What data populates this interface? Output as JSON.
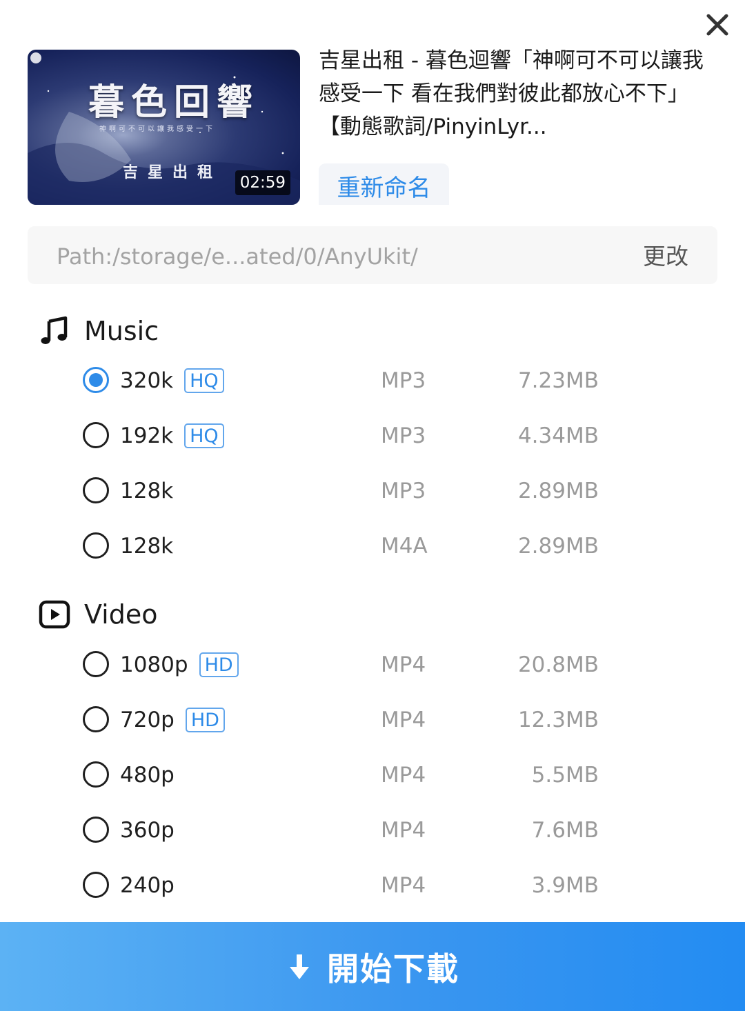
{
  "header": {
    "close_icon": "close-icon"
  },
  "video": {
    "duration": "02:59",
    "thumbnail_title": "暮色回響",
    "thumbnail_subtitle": "神啊可不可以讓我感受一下",
    "thumbnail_artist": "吉星出租",
    "title": "吉星出租 - 暮色迴響「神啊可不可以讓我感受一下 看在我們對彼此都放心不下」【動態歌詞/PinyinLyr...",
    "rename_label": "重新命名"
  },
  "path": {
    "value": "Path:/storage/e...ated/0/AnyUkit/",
    "change_label": "更改"
  },
  "music": {
    "label": "Music",
    "icon": "music-note-icon",
    "options": [
      {
        "quality": "320k",
        "badge": "HQ",
        "format": "MP3",
        "size": "7.23MB",
        "selected": true
      },
      {
        "quality": "192k",
        "badge": "HQ",
        "format": "MP3",
        "size": "4.34MB",
        "selected": false
      },
      {
        "quality": "128k",
        "badge": "",
        "format": "MP3",
        "size": "2.89MB",
        "selected": false
      },
      {
        "quality": "128k",
        "badge": "",
        "format": "M4A",
        "size": "2.89MB",
        "selected": false
      }
    ]
  },
  "video_section": {
    "label": "Video",
    "icon": "play-icon",
    "options": [
      {
        "quality": "1080p",
        "badge": "HD",
        "format": "MP4",
        "size": "20.8MB",
        "selected": false
      },
      {
        "quality": "720p",
        "badge": "HD",
        "format": "MP4",
        "size": "12.3MB",
        "selected": false
      },
      {
        "quality": "480p",
        "badge": "",
        "format": "MP4",
        "size": "5.5MB",
        "selected": false
      },
      {
        "quality": "360p",
        "badge": "",
        "format": "MP4",
        "size": "7.6MB",
        "selected": false
      },
      {
        "quality": "240p",
        "badge": "",
        "format": "MP4",
        "size": "3.9MB",
        "selected": false
      }
    ]
  },
  "footer": {
    "download_label": "開始下載",
    "download_icon": "download-arrow-icon"
  },
  "colors": {
    "accent": "#2e8be8",
    "button_gradient_start": "#5cb2f4",
    "button_gradient_end": "#238cf2",
    "muted_text": "#9a9a9a"
  }
}
